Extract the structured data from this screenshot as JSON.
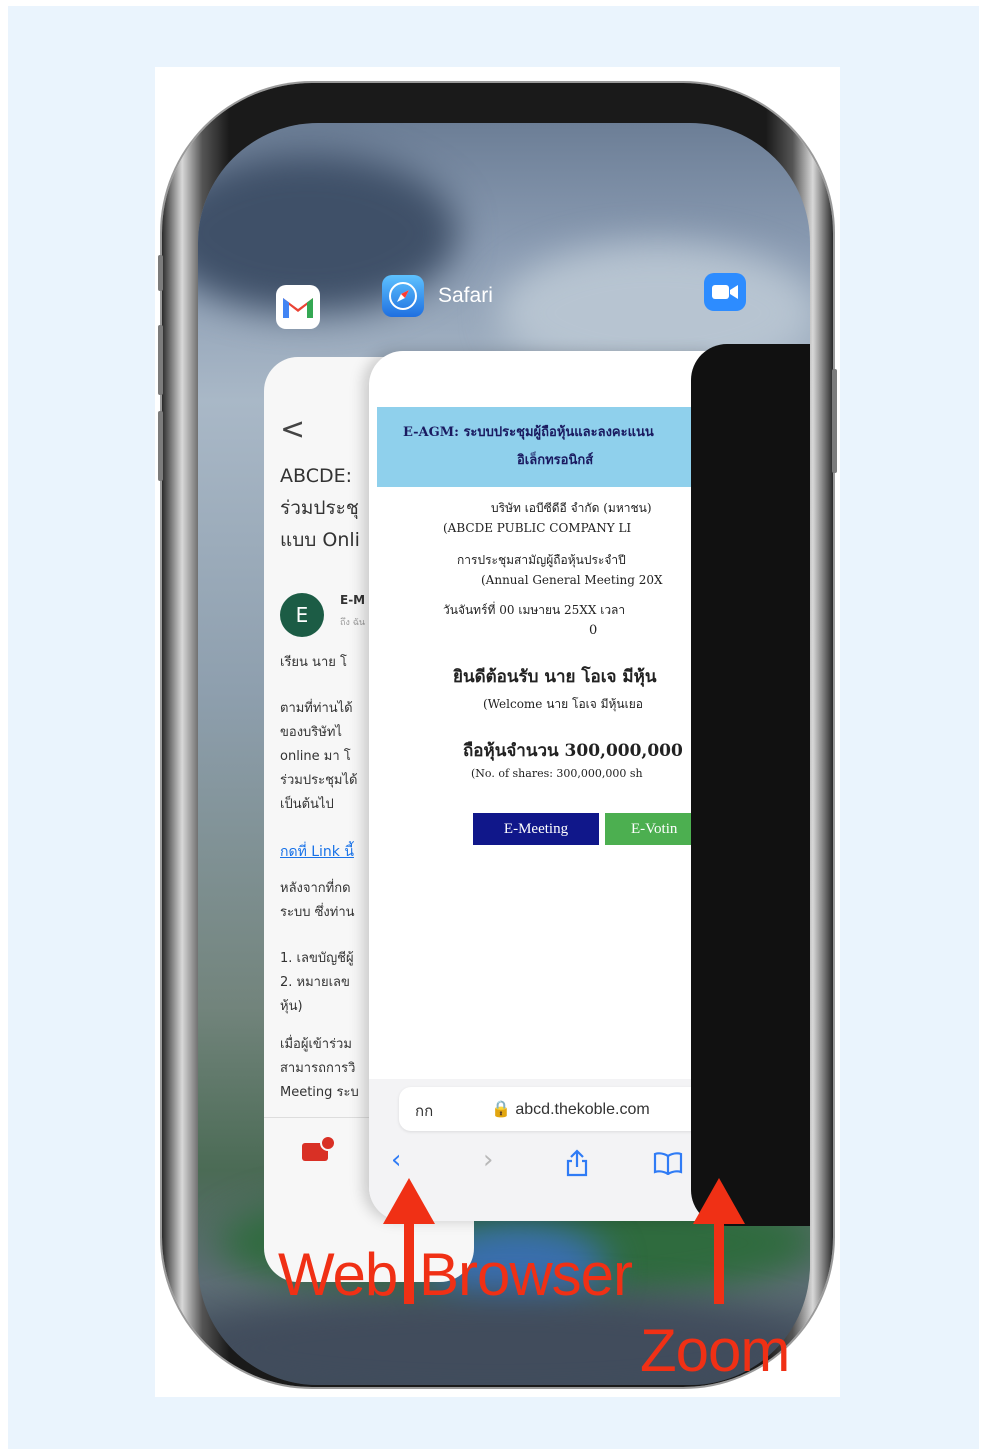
{
  "apps": {
    "safari_name": "Safari",
    "colors": {
      "gmail_red": "#ea4335",
      "safari_blue": "#2f80ed",
      "zoom_blue": "#2d8cff"
    }
  },
  "gmail_card": {
    "back": "<",
    "subject_lines": [
      "ABCDE: ",
      "ร่วมประชุ",
      "แบบ Onli"
    ],
    "avatar_letter": "E",
    "sender": "E-M",
    "sender_sub": "ถึง ฉัน",
    "greeting": "เรียน นาย โ",
    "body": [
      "ตามที่ท่านได้",
      "ของบริษัทไ",
      "online มา โ",
      "ร่วมประชุมได้",
      "เป็นต้นไป"
    ],
    "link": "กดที่ Link นี้",
    "body2": [
      "หลังจากที่กด",
      "ระบบ ซึ่งท่าน"
    ],
    "list": [
      "1. เลขบัญชีผู้",
      "2. หมายเลข",
      "หุ้น)"
    ],
    "body3": [
      "เมื่อผู้เข้าร่วม",
      "สามารถการวิ",
      "Meeting ระบ"
    ]
  },
  "safari_card": {
    "header_line1": "E-AGM: ระบบประชุมผู้ถือหุ้นและลงคะแนน",
    "header_line2": "อิเล็กทรอนิกส์",
    "company_th": "บริษัท เอบีซีดีอี จำกัด (มหาชน)",
    "company_en": "(ABCDE PUBLIC COMPANY LI",
    "meeting_th": "การประชุมสามัญผู้ถือหุ้นประจำปี",
    "meeting_en": "(Annual General Meeting 20X",
    "date_th": "วันจันทร์ที่ 00 เมษายน 25XX เวลา",
    "date_zero": "0",
    "welcome_th": "ยินดีต้อนรับ นาย โอเจ มีหุ้น",
    "welcome_en": "(Welcome นาย โอเจ มีหุ้นเยอ",
    "shares_th": "ถือหุ้นจำนวน 300,000,000",
    "shares_en": "(No. of shares: 300,000,000 sh",
    "btn_meeting": "E-Meeting",
    "btn_voting": "E-Votin",
    "aa": "กก",
    "url": "🔒 abcd.thekoble.com",
    "colors": {
      "header_bg": "#8fd0ec",
      "btn_meeting": "#10178a",
      "btn_voting": "#4caf50"
    }
  },
  "annotations": {
    "web_browser": "Web Browser",
    "zoom": "Zoom",
    "color": "#f03015"
  }
}
